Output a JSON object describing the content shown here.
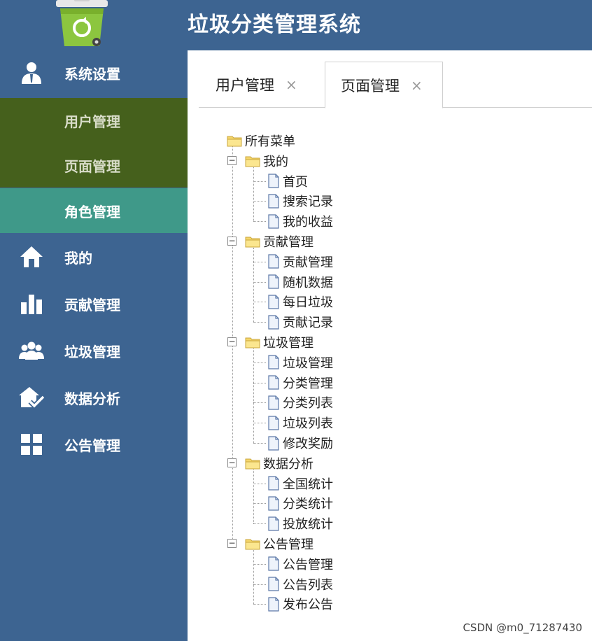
{
  "app": {
    "title": "垃圾分类管理系统"
  },
  "sidebar": {
    "items": [
      {
        "label": "系统设置",
        "icon": "user-icon"
      },
      {
        "label": "我的",
        "icon": "home-icon"
      },
      {
        "label": "贡献管理",
        "icon": "bar-chart-icon"
      },
      {
        "label": "垃圾管理",
        "icon": "group-icon"
      },
      {
        "label": "数据分析",
        "icon": "house-check-icon"
      },
      {
        "label": "公告管理",
        "icon": "grid-icon"
      }
    ],
    "subitems": [
      {
        "label": "用户管理"
      },
      {
        "label": "页面管理"
      },
      {
        "label": "角色管理",
        "active": true
      }
    ]
  },
  "tabs": [
    {
      "label": "用户管理",
      "close": "×"
    },
    {
      "label": "页面管理",
      "close": "×",
      "active": true
    }
  ],
  "tree": {
    "root": "所有菜单",
    "groups": [
      {
        "label": "我的",
        "toggle": "−",
        "children": [
          "首页",
          "搜索记录",
          "我的收益"
        ]
      },
      {
        "label": "贡献管理",
        "toggle": "−",
        "children": [
          "贡献管理",
          "随机数据",
          "每日垃圾",
          "贡献记录"
        ]
      },
      {
        "label": "垃圾管理",
        "toggle": "−",
        "children": [
          "垃圾管理",
          "分类管理",
          "分类列表",
          "垃圾列表",
          "修改奖励"
        ]
      },
      {
        "label": "数据分析",
        "toggle": "−",
        "children": [
          "全国统计",
          "分类统计",
          "投放统计"
        ]
      },
      {
        "label": "公告管理",
        "toggle": "−",
        "children": [
          "公告管理",
          "公告列表",
          "发布公告"
        ]
      }
    ]
  },
  "footer": {
    "watermark": "CSDN @m0_71287430"
  },
  "colors": {
    "header": "#3d6491",
    "sidebar": "#3d6491",
    "submenu": "#45601c",
    "submenu_active": "#3f9989"
  }
}
